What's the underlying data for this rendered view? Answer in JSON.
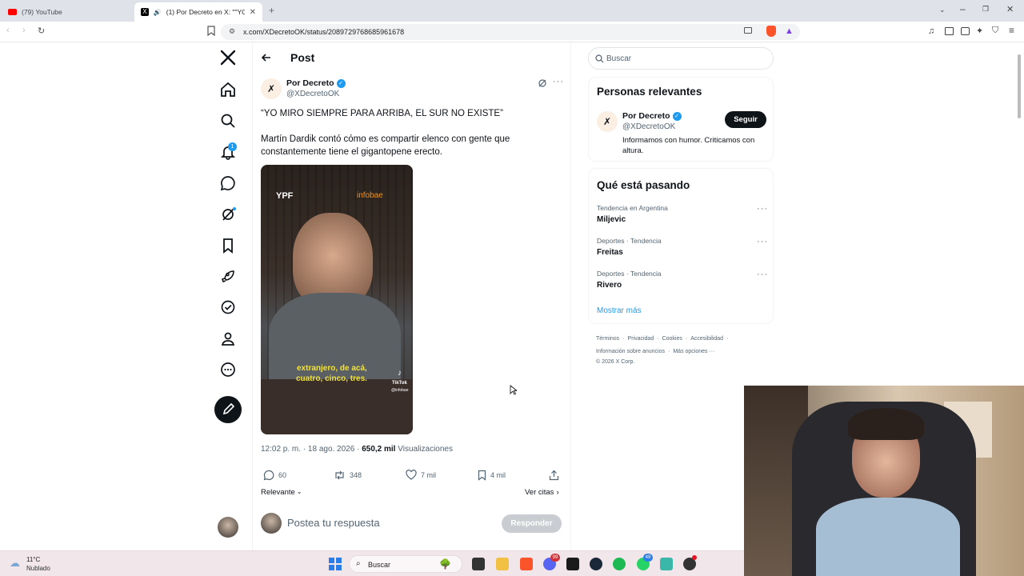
{
  "browser": {
    "tabs": [
      {
        "title": "(79) YouTube"
      },
      {
        "title": "(1) Por Decreto en X: \"\"YO MI..."
      }
    ],
    "url": "x.com/XDecretoOK/status/2089729768685961678"
  },
  "sidebar": {
    "notifications_badge": "1"
  },
  "header": {
    "title": "Post"
  },
  "post": {
    "author_name": "Por Decreto",
    "author_handle": "@XDecretoOK",
    "headline": "“YO MIRO SIEMPRE PARA ARRIBA, EL SUR NO EXISTE”",
    "body": "Martín Dardik contó cómo es compartir elenco con gente que constantemente tiene el gigantopene erecto.",
    "video": {
      "brand_left": "YPF",
      "brand_right": "infobae",
      "subtitle_line1": "extranjero, de acá,",
      "subtitle_line2": "cuatro, cinco, tres.",
      "watermark": "TikTok",
      "watermark_handle": "@infobae"
    },
    "time": "12:02 p. m. · 18 ago. 2026 ·",
    "views_count": "650,2 mil",
    "views_label": "Visualizaciones",
    "replies": "60",
    "reposts": "348",
    "likes": "7 mil",
    "bookmarks": "4 mil",
    "sort_label": "Relevante",
    "quotes_label": "Ver citas",
    "reply_placeholder": "Postea tu respuesta",
    "reply_button": "Responder"
  },
  "right": {
    "search_placeholder": "Buscar",
    "relevant_title": "Personas relevantes",
    "person_name": "Por Decreto",
    "person_handle": "@XDecretoOK",
    "person_bio": "Informamos con humor. Criticamos con altura.",
    "follow_label": "Seguir",
    "trending_title": "Qué está pasando",
    "trends": [
      {
        "category": "Tendencia en Argentina",
        "topic": "Miljevic"
      },
      {
        "category": "Deportes · Tendencia",
        "topic": "Freitas"
      },
      {
        "category": "Deportes · Tendencia",
        "topic": "Rivero"
      }
    ],
    "show_more": "Mostrar más",
    "footer_links": [
      "Términos",
      "Privacidad",
      "Cookies",
      "Accesibilidad",
      "Información sobre anuncios",
      "Más opciones ···"
    ],
    "copyright": "© 2026 X Corp."
  },
  "taskbar": {
    "weather_temp": "11°C",
    "weather_desc": "Nublado",
    "search_label": "Buscar",
    "badge_a": "99",
    "badge_b": "49"
  },
  "colors": {
    "accent": "#1d9bf0",
    "text": "#0f1419",
    "muted": "#536471"
  }
}
